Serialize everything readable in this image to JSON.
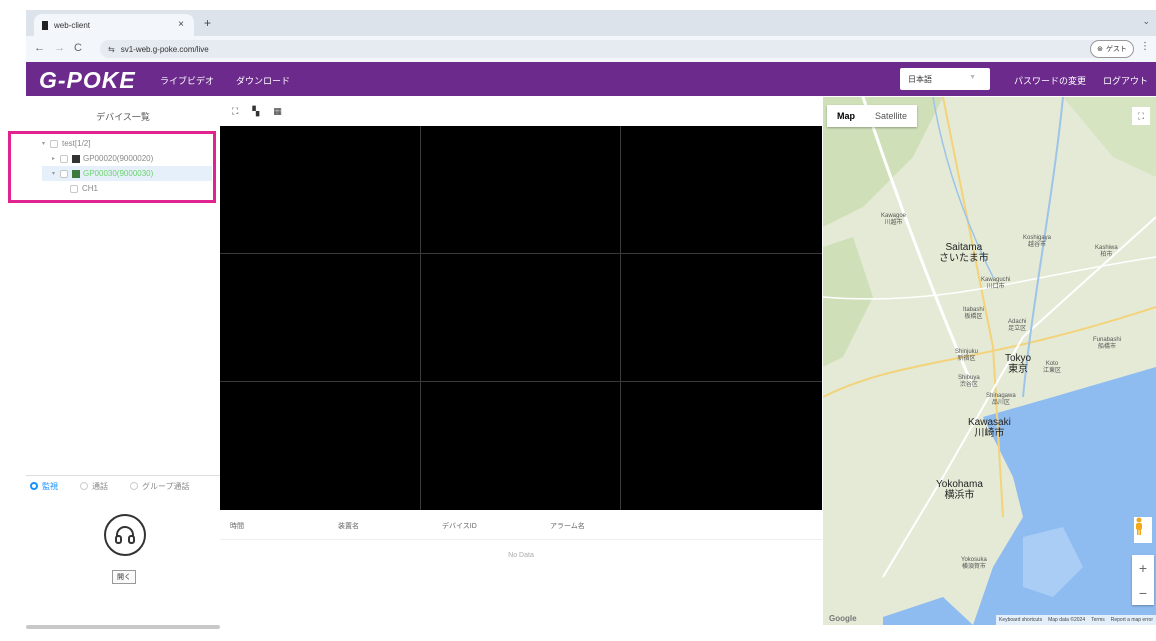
{
  "browser": {
    "tab_title": "web-client",
    "tab_close": "×",
    "new_tab": "+",
    "url": "sv1-web.g-poke.com/live",
    "profile_label": "ゲスト",
    "back": "←",
    "forward": "→",
    "reload": "C"
  },
  "app": {
    "logo": "G-POKE",
    "nav": {
      "live_video": "ライブビデオ",
      "download": "ダウンロード"
    },
    "language": "日本語",
    "change_password": "パスワードの変更",
    "logout": "ログアウト"
  },
  "device_panel": {
    "title": "デバイス一覧",
    "tree": [
      {
        "label": "test[1/2]"
      },
      {
        "label": "GP00020(9000020)"
      },
      {
        "label": "GP00030(9000030)"
      },
      {
        "label": "CH1"
      }
    ]
  },
  "modes": [
    {
      "label": "監視",
      "active": true
    },
    {
      "label": "通話",
      "active": false
    },
    {
      "label": "グループ通話",
      "active": false
    }
  ],
  "talk": {
    "open_button": "開く"
  },
  "alarm_table": {
    "columns": [
      "時間",
      "装置名",
      "デバイスID",
      "アラーム名"
    ],
    "empty_text": "No Data"
  },
  "map": {
    "type_map": "Map",
    "type_satellite": "Satellite",
    "cities": {
      "saitama": "Saitama\nさいたま市",
      "tokyo": "Tokyo\n東京",
      "kawasaki": "Kawasaki\n川崎市",
      "yokohama": "Yokohama\n横浜市",
      "kawaguchi": "Kawaguchi\n川口市",
      "itabashi": "Itabashi\n板橋区",
      "adachi": "Adachi\n足立区",
      "shinjuku": "Shinjuku\n新宿区",
      "shibuya": "Shibuya\n渋谷区",
      "shinagawa": "Shinagawa\n品川区",
      "koto": "Koto\n江東区",
      "funabashi": "Funabashi\n船橋市",
      "kawagoe": "Kawagoe\n川越市",
      "koshigaya": "Koshigaya\n越谷市",
      "kashiwa": "Kashiwa\n柏市",
      "yokosuka": "Yokosuka\n横須賀市"
    },
    "attribution": {
      "shortcuts": "Keyboard shortcuts",
      "data": "Map data ©2024",
      "terms": "Terms",
      "report": "Report a map error"
    },
    "google": "Google"
  }
}
